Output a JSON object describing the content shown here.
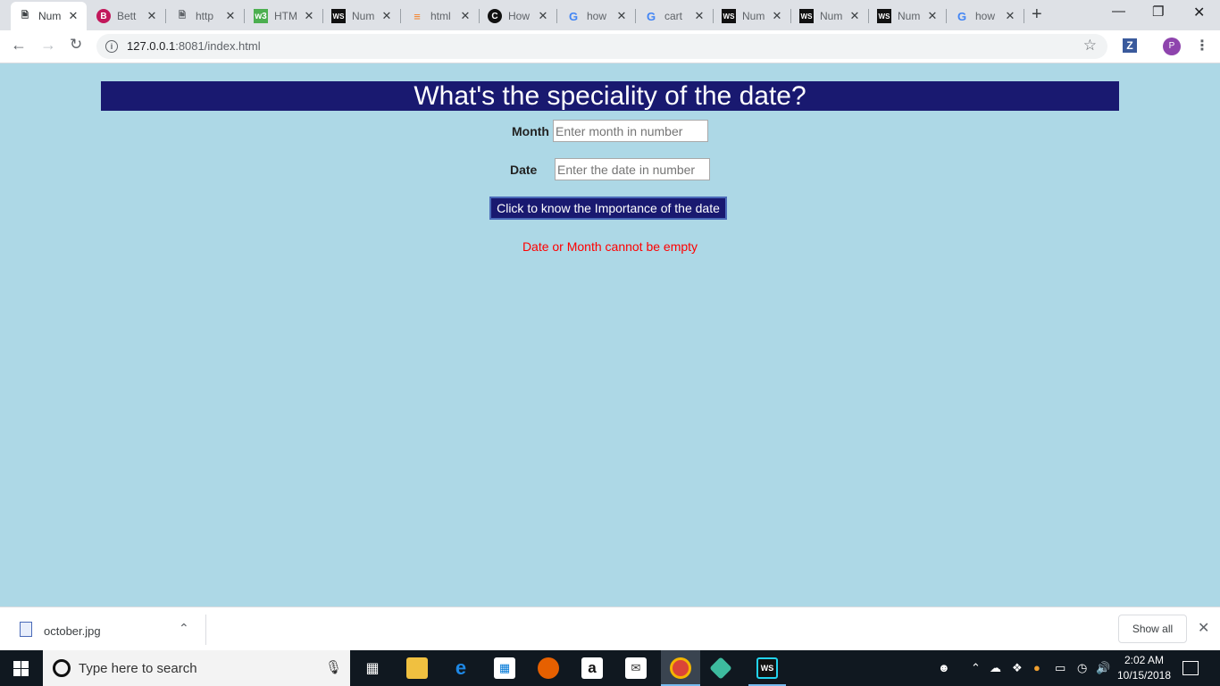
{
  "browser": {
    "tabs": [
      {
        "label": "Num",
        "icon": "page-icon",
        "active": true
      },
      {
        "label": "Bett",
        "icon": "bootstrap-icon"
      },
      {
        "label": "http",
        "icon": "page-icon"
      },
      {
        "label": "HTM",
        "icon": "w3schools-icon"
      },
      {
        "label": "Num",
        "icon": "webstorm-icon"
      },
      {
        "label": "html",
        "icon": "stackoverflow-icon"
      },
      {
        "label": "How",
        "icon": "codepen-icon"
      },
      {
        "label": "how",
        "icon": "google-icon"
      },
      {
        "label": "cart",
        "icon": "google-icon"
      },
      {
        "label": "Num",
        "icon": "webstorm-icon"
      },
      {
        "label": "Num",
        "icon": "webstorm-icon"
      },
      {
        "label": "Num",
        "icon": "webstorm-icon"
      },
      {
        "label": "how",
        "icon": "google-icon"
      }
    ],
    "url_host": "127.0.0.1",
    "url_rest": ":8081/index.html",
    "extension_label": "Z",
    "profile_initial": "P"
  },
  "page": {
    "title": "What's the speciality of the date?",
    "month_label": "Month",
    "month_placeholder": "Enter month in number",
    "date_label": "Date",
    "date_placeholder": "Enter the date in number",
    "submit_label": "Click to know the Importance of the date",
    "error_message": "Date or Month cannot be empty"
  },
  "downloads": {
    "file_name": "october.jpg",
    "show_all_label": "Show all"
  },
  "taskbar": {
    "search_placeholder": "Type here to search",
    "time": "2:02 AM",
    "date": "10/15/2018"
  },
  "colors": {
    "page_bg": "#add8e6",
    "heading_bg": "#191970",
    "error": "#ff0000"
  }
}
